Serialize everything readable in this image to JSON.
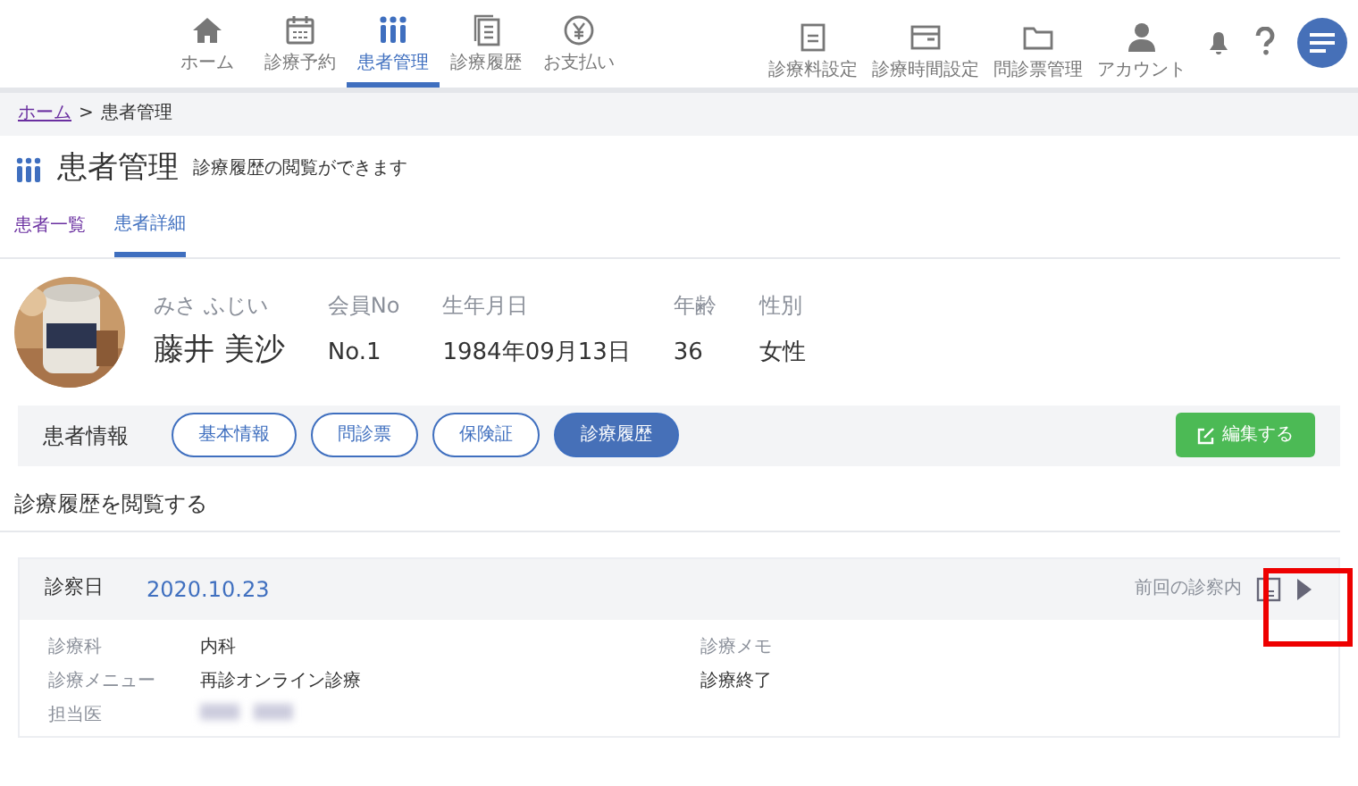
{
  "nav": [
    {
      "label": "ホーム",
      "selected": false
    },
    {
      "label": "診療予約",
      "selected": false
    },
    {
      "label": "患者管理",
      "selected": true
    },
    {
      "label": "診療履歴",
      "selected": false
    },
    {
      "label": "お支払い",
      "selected": false
    }
  ],
  "settings": [
    {
      "label": "診療料設定"
    },
    {
      "label": "診療時間設定"
    },
    {
      "label": "問診票管理"
    },
    {
      "label": "アカウント"
    }
  ],
  "breadcrumb": [
    {
      "label": "ホーム",
      "link": true
    },
    {
      "label": ">",
      "link": false
    },
    {
      "label": "患者管理",
      "link": false
    }
  ],
  "page": {
    "title": "患者管理",
    "subtitle": "診療履歴の閲覧ができます"
  },
  "tabs": [
    {
      "label": "患者一覧",
      "selected": false
    },
    {
      "label": "患者詳細",
      "selected": true
    }
  ],
  "patient": {
    "kana": "みさ ふじい",
    "name": "藤井 美沙",
    "fields": [
      {
        "label": "会員No",
        "value": "No.1"
      },
      {
        "label": "生年月日",
        "value": "1984年09月13日"
      },
      {
        "label": "年齢",
        "value": "36"
      },
      {
        "label": "性別",
        "value": "女性"
      }
    ]
  },
  "info_bar": {
    "title": "患者情報",
    "buttons": [
      {
        "label": "基本情報",
        "selected": false
      },
      {
        "label": "問診票",
        "selected": false
      },
      {
        "label": "保険証",
        "selected": false
      },
      {
        "label": "診療履歴",
        "selected": true
      }
    ],
    "edit_button": "編集する"
  },
  "section_title": "診療履歴を閲覧する",
  "record": {
    "date_label": "診察日",
    "date": "2020.10.23",
    "previous_label": "前回の診察内",
    "rows": [
      {
        "label": "診療科",
        "value": "内科",
        "blurred": false
      },
      {
        "label": "診療メニュー",
        "value": "再診オンライン診療",
        "blurred": false
      },
      {
        "label": "担当医",
        "blurred": true
      }
    ],
    "memo_label": "診療メモ",
    "memo": "診療終了"
  }
}
